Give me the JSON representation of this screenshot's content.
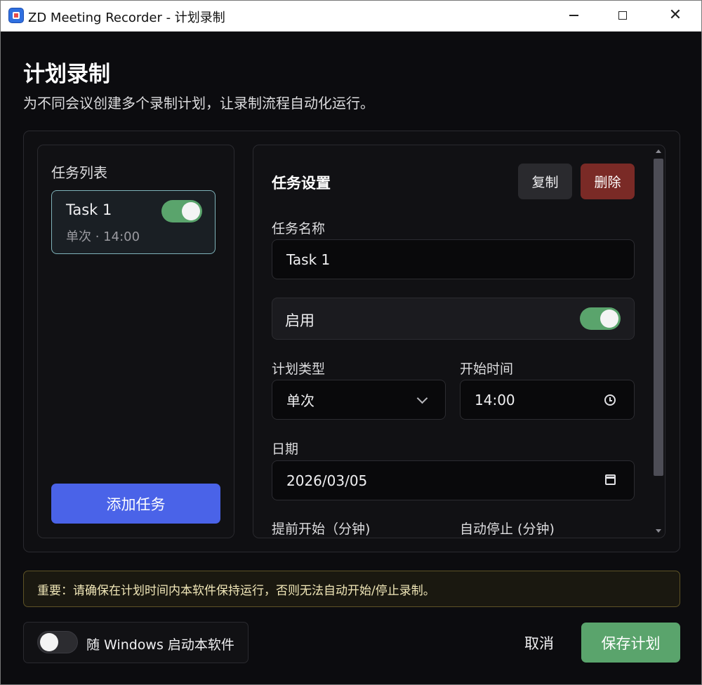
{
  "window": {
    "title": "ZD Meeting Recorder - 计划录制"
  },
  "header": {
    "title": "计划录制",
    "subtitle": "为不同会议创建多个录制计划，让录制流程自动化运行。"
  },
  "task_list": {
    "title": "任务列表",
    "tasks": [
      {
        "name": "Task 1",
        "meta": "单次 · 14:00",
        "enabled": true
      }
    ],
    "add_label": "添加任务"
  },
  "settings": {
    "title": "任务设置",
    "copy_label": "复制",
    "delete_label": "删除",
    "name_label": "任务名称",
    "name_value": "Task 1",
    "enable_label": "启用",
    "enabled": true,
    "type_label": "计划类型",
    "type_value": "单次",
    "start_time_label": "开始时间",
    "start_time_value": "14:00",
    "date_label": "日期",
    "date_value": "2026/03/05",
    "advance_label": "提前开始（分钟)",
    "auto_stop_label": "自动停止 (分钟)"
  },
  "warning": {
    "text": "重要：请确保在计划时间内本软件保持运行，否则无法自动开始/停止录制。"
  },
  "footer": {
    "autostart_label": "随 Windows 启动本软件",
    "autostart_enabled": false,
    "cancel_label": "取消",
    "save_label": "保存计划"
  },
  "colors": {
    "accent_blue": "#4a63e8",
    "accent_green": "#5aa46c",
    "danger": "#7a2a26",
    "warning_border": "#5e5326"
  },
  "icons": [
    "app-icon",
    "minimize-icon",
    "maximize-icon",
    "close-icon",
    "chevron-down-icon",
    "clock-icon",
    "calendar-icon"
  ]
}
